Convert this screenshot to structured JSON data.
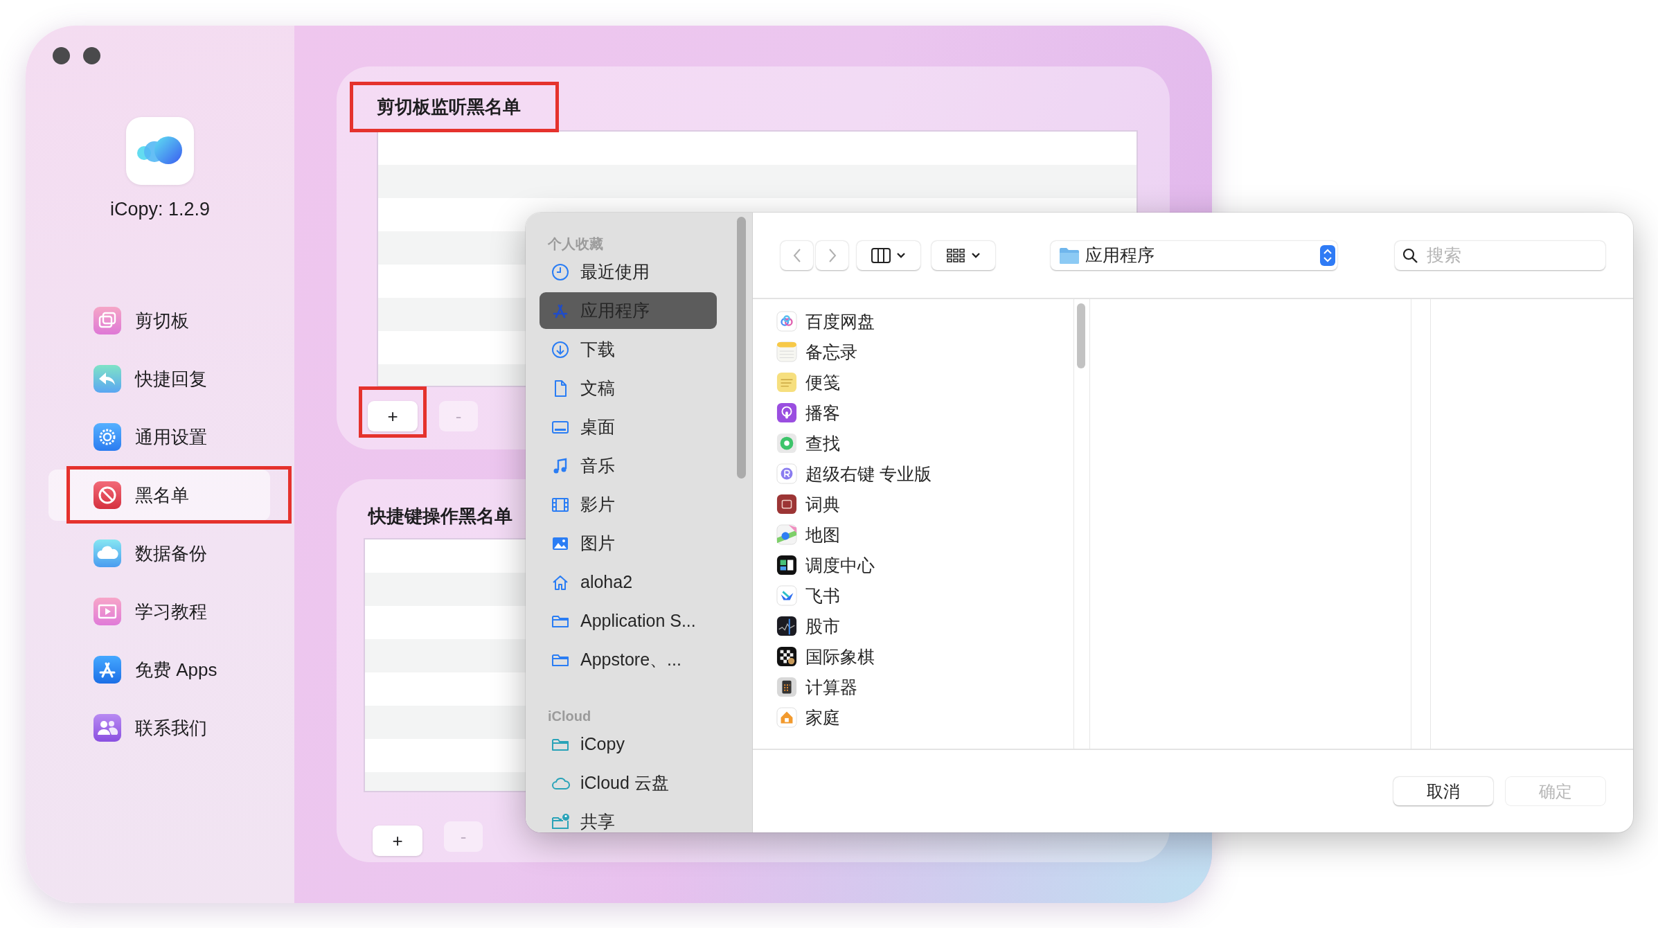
{
  "app": {
    "version_label": "iCopy: 1.2.9"
  },
  "nav": [
    {
      "label": "剪切板",
      "selected": false,
      "highlighted": false
    },
    {
      "label": "快捷回复",
      "selected": false,
      "highlighted": false
    },
    {
      "label": "通用设置",
      "selected": false,
      "highlighted": false
    },
    {
      "label": "黑名单",
      "selected": true,
      "highlighted": true
    },
    {
      "label": "数据备份",
      "selected": false,
      "highlighted": false
    },
    {
      "label": "学习教程",
      "selected": false,
      "highlighted": false
    },
    {
      "label": "免费 Apps",
      "selected": false,
      "highlighted": false
    },
    {
      "label": "联系我们",
      "selected": false,
      "highlighted": false
    }
  ],
  "panels": [
    {
      "title": "剪切板监听黑名单",
      "title_highlighted": true,
      "add_button": {
        "label": "+",
        "highlighted": true
      },
      "remove_button": {
        "label": "-",
        "disabled": true
      }
    },
    {
      "title": "快捷键操作黑名单",
      "title_highlighted": false,
      "add_button": {
        "label": "+",
        "highlighted": false
      },
      "remove_button": {
        "label": "-",
        "disabled": true
      }
    }
  ],
  "file_dialog": {
    "sidebar": [
      {
        "section": "个人收藏",
        "items": [
          {
            "label": "最近使用",
            "selected": false
          },
          {
            "label": "应用程序",
            "selected": true
          },
          {
            "label": "下载",
            "selected": false
          },
          {
            "label": "文稿",
            "selected": false
          },
          {
            "label": "桌面",
            "selected": false
          },
          {
            "label": "音乐",
            "selected": false
          },
          {
            "label": "影片",
            "selected": false
          },
          {
            "label": "图片",
            "selected": false
          },
          {
            "label": "aloha2",
            "selected": false
          },
          {
            "label": "Application S...",
            "selected": false
          },
          {
            "label": "Appstore、...",
            "selected": false
          }
        ]
      },
      {
        "section": "iCloud",
        "items": [
          {
            "label": "iCopy",
            "selected": false
          },
          {
            "label": "iCloud 云盘",
            "selected": false
          },
          {
            "label": "共享",
            "selected": false
          }
        ]
      }
    ],
    "location": "应用程序",
    "search": {
      "placeholder": "搜索"
    },
    "files": [
      {
        "name": "百度网盘"
      },
      {
        "name": "备忘录"
      },
      {
        "name": "便笺"
      },
      {
        "name": "播客"
      },
      {
        "name": "查找"
      },
      {
        "name": "超级右键 专业版"
      },
      {
        "name": "词典"
      },
      {
        "name": "地图"
      },
      {
        "name": "调度中心"
      },
      {
        "name": "飞书"
      },
      {
        "name": "股市"
      },
      {
        "name": "国际象棋"
      },
      {
        "name": "计算器"
      },
      {
        "name": "家庭"
      }
    ],
    "buttons": [
      {
        "label": "取消",
        "disabled": false
      },
      {
        "label": "确定",
        "disabled": true
      }
    ]
  }
}
